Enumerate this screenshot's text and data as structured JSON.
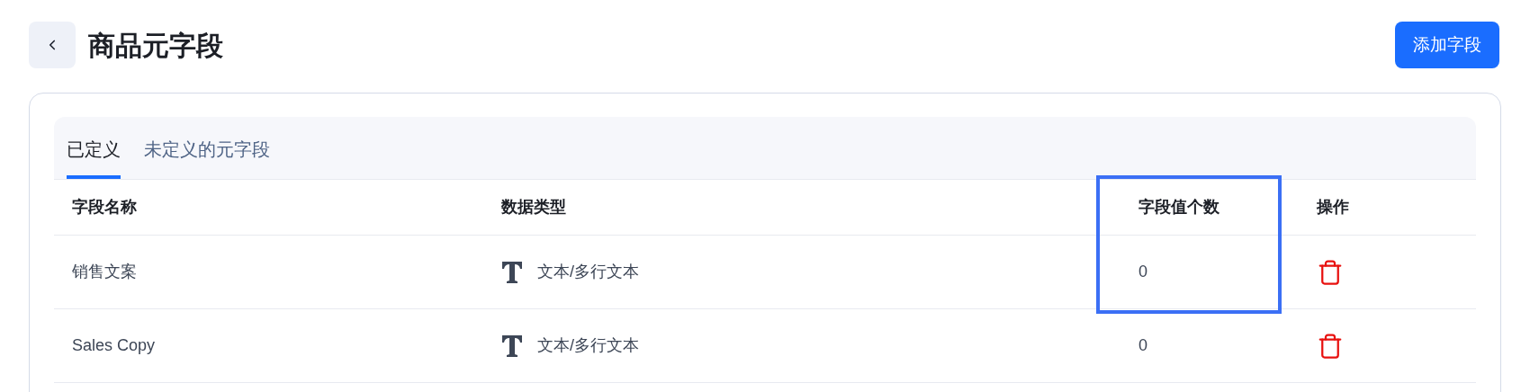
{
  "header": {
    "title": "商品元字段",
    "add_button": "添加字段"
  },
  "tabs": [
    {
      "label": "已定义",
      "selected": true
    },
    {
      "label": "未定义的元字段",
      "selected": false
    }
  ],
  "table": {
    "columns": [
      "字段名称",
      "数据类型",
      "字段值个数",
      "操作"
    ],
    "highlight_frame": true,
    "rows": [
      {
        "name": "销售文案",
        "type": "文本/多行文本",
        "count": "0"
      },
      {
        "name": "Sales Copy",
        "type": "文本/多行文本",
        "count": "0"
      }
    ]
  }
}
